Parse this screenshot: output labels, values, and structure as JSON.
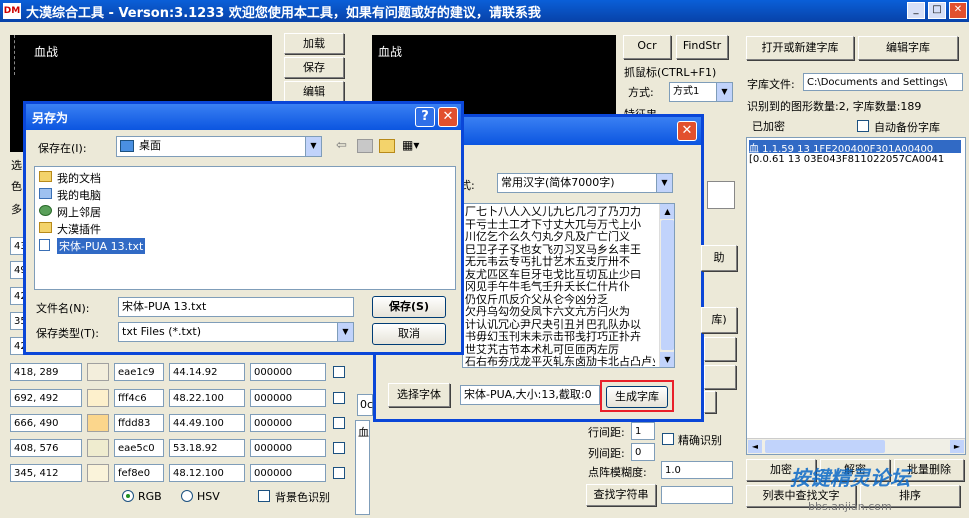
{
  "title_bar": {
    "logo": "DM",
    "text": "大漠综合工具 -  Verson:3.1233  欢迎您使用本工具，如果有问题或好的建议，请联系我"
  },
  "left_panel": {
    "preview_label": "血战",
    "buttons": [
      "加载",
      "保存",
      "编辑"
    ],
    "side_labels": [
      "选",
      "色",
      "多"
    ],
    "partial_coords": [
      "43",
      "49",
      "42",
      "35",
      "42"
    ],
    "color_rows": [
      {
        "coord": "418, 289",
        "swatch": "#f3eedc",
        "hex": "eae1c9",
        "hsv": "44.14.92",
        "offset": "000000"
      },
      {
        "coord": "692, 492",
        "swatch": "#fdf0cc",
        "hex": "fff4c6",
        "hsv": "48.22.100",
        "offset": "000000"
      },
      {
        "coord": "666, 490",
        "swatch": "#fbd68c",
        "hex": "ffdd83",
        "hsv": "44.49.100",
        "offset": "000000"
      },
      {
        "coord": "408, 576",
        "swatch": "#efeccf",
        "hex": "eae5c0",
        "hsv": "53.18.92",
        "offset": "000000"
      },
      {
        "coord": "345, 412",
        "swatch": "#faf3da",
        "hex": "fef8e0",
        "hsv": "48.12.100",
        "offset": "000000"
      }
    ],
    "mode_rgb": "RGB",
    "mode_hsv": "HSV",
    "bg_recognize": "背景色识别"
  },
  "mid_panel": {
    "preview_label": "血战",
    "ocr_btn": "Ocr",
    "findstr_btn": "FindStr",
    "grab_label": "抓鼠标(CTRL+F1)",
    "method_label": "方式:",
    "method_value": "方式1",
    "partial_label": "特征串",
    "row_spacing_label": "行间距:",
    "row_spacing_value": "1",
    "col_spacing_label": "列间距:",
    "col_spacing_value": "0",
    "precise_label": "精确识别",
    "blur_label": "点阵模糊度:",
    "blur_value": "1.0",
    "find_btn": "查找字符串",
    "result_partial": "血",
    "partial_0": "0c"
  },
  "right_panel": {
    "open_btn": "打开或新建字库",
    "edit_btn": "编辑字库",
    "file_label": "字库文件:",
    "file_value": "C:\\Documents and Settings\\",
    "count_label": "识别到的图形数量:2, 字库数量:189",
    "encrypted_label": "已加密",
    "auto_backup_label": "自动备份字库",
    "list_items": [
      "血 1.1.59 13 1FE200400F301A00400",
      "[0.0.61 13 03E043F811022057CA0041"
    ],
    "encrypt_btn": "加密",
    "decrypt_btn": "解密",
    "batch_delete_btn": "批量删除",
    "list_find_btn": "列表中查找文字",
    "sort_btn": "排序"
  },
  "font_dialog": {
    "style_label": "式:",
    "charset_value": "常用汉字(简体7000字)",
    "chars_lines": [
      "厂七卜八人入乂儿九匕几刁了乃刀力",
      "干亏士土工才下寸丈大兀与万弋上小",
      "川亿乞个么久勺丸夕凡及广亡门义",
      "巳卫孑子孓也女飞刃习叉马乡幺丰王",
      "无元韦云专丐扎廿艺木五支厅卅不",
      "友尤匹区车巨牙屯戈比互切瓦止少曰",
      "冈见手午牛毛气壬升夭长仁什片仆",
      "仍仅斤爪反介父从仑今凶分乏",
      "欠丹乌勾勿殳凤卞六文亢方闩火为",
      "计认讥冗心尹尺夬引丑爿巴孔队办以",
      "书毋幻玉刊末未示击邗戋打巧正扑卉",
      "世艾艽古节本术札可叵匝丙左厉",
      "石右布夯戊龙平灭轧东卤劢卡北占凸卢业旧帅"
    ],
    "select_font_btn": "选择字体",
    "font_info": "宋体-PUA,大小:13,截取:0",
    "generate_btn": "生成字库",
    "partial_help": "助",
    "partial_lib": "库)"
  },
  "save_dialog": {
    "title": "另存为",
    "save_in_label": "保存在(I):",
    "save_in_value": "桌面",
    "items": [
      "我的文档",
      "我的电脑",
      "网上邻居",
      "大漠插件",
      "宋体-PUA 13.txt"
    ],
    "filename_label": "文件名(N):",
    "filename_value": "宋体-PUA 13.txt",
    "filetype_label": "保存类型(T):",
    "filetype_value": "txt Files (*.txt)",
    "save_btn": "保存(S)",
    "cancel_btn": "取消"
  },
  "watermark": {
    "text": "按键精灵论坛",
    "url": "bbs.anjian.com"
  }
}
